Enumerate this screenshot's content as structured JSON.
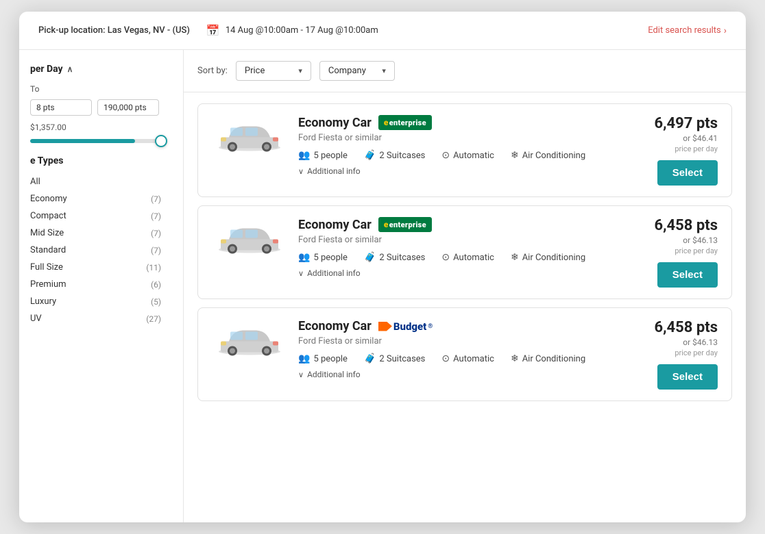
{
  "header": {
    "location_label": "Pick-up location: Las Vegas, NV - (US)",
    "dates_label": "14 Aug @10:00am - 17 Aug @10:00am",
    "edit_label": "Edit search results"
  },
  "sidebar": {
    "price_section_title": "per Day",
    "price_to_label": "To",
    "price_min_value": "8 pts",
    "price_max_value": "190,000 pts",
    "price_display": "$1,357.00",
    "vehicle_types_title": "e Types",
    "vehicle_types": [
      {
        "label": "All",
        "count": ""
      },
      {
        "label": "Economy",
        "count": "(7)"
      },
      {
        "label": "Compact",
        "count": "(7)"
      },
      {
        "label": "Mid Size",
        "count": "(7)"
      },
      {
        "label": "Standard",
        "count": "(7)"
      },
      {
        "label": "Full Size",
        "count": "(11)"
      },
      {
        "label": "Premium",
        "count": "(6)"
      },
      {
        "label": "Luxury",
        "count": "(5)"
      },
      {
        "label": "UV",
        "count": "(27)"
      }
    ]
  },
  "sort_bar": {
    "label": "Sort by:",
    "option1": "Price",
    "option2": "Company"
  },
  "cars": [
    {
      "type": "Economy Car",
      "brand": "enterprise",
      "subtitle": "Ford Fiesta or similar",
      "people": "5 people",
      "suitcases": "2 Suitcases",
      "transmission": "Automatic",
      "ac": "Air Conditioning",
      "pts": "6,497 pts",
      "alt_price": "or $46.41",
      "per_day": "price per day",
      "select_label": "Select",
      "additional_info": "Additional info"
    },
    {
      "type": "Economy Car",
      "brand": "enterprise",
      "subtitle": "Ford Fiesta or similar",
      "people": "5 people",
      "suitcases": "2 Suitcases",
      "transmission": "Automatic",
      "ac": "Air Conditioning",
      "pts": "6,458 pts",
      "alt_price": "or $46.13",
      "per_day": "price per day",
      "select_label": "Select",
      "additional_info": "Additional info"
    },
    {
      "type": "Economy Car",
      "brand": "budget",
      "subtitle": "Ford Fiesta or similar",
      "people": "5 people",
      "suitcases": "2 Suitcases",
      "transmission": "Automatic",
      "ac": "Air Conditioning",
      "pts": "6,458 pts",
      "alt_price": "or $46.13",
      "per_day": "price per day",
      "select_label": "Select",
      "additional_info": "Additional info"
    }
  ]
}
